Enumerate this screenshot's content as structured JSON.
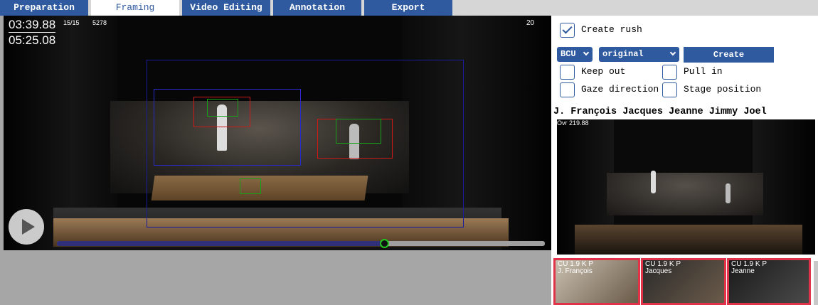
{
  "tabs": [
    {
      "label": "Preparation",
      "active": false
    },
    {
      "label": "Framing",
      "active": true
    },
    {
      "label": "Video Editing",
      "active": false
    },
    {
      "label": "Annotation",
      "active": false
    },
    {
      "label": "Export",
      "active": false
    }
  ],
  "video": {
    "current_time": "03:39.88",
    "total_time": "05:25.08",
    "frame_counter": "15/15",
    "frame_id": "5278",
    "corner_number": "20",
    "progress": 0.67,
    "colors": {
      "frame_outer": "#1b1b9e",
      "frame_inner": "#2a2acc",
      "box_red": "#d01818",
      "box_green": "#18a018",
      "timeline": "#2f2f7a",
      "knob": "#22c81e"
    }
  },
  "controls": {
    "create_rush_label": "Create rush",
    "create_rush_checked": true,
    "shot_size": "BCU",
    "framing_mode": "original",
    "create_label": "Create",
    "options": [
      {
        "label": "Keep out",
        "checked": false
      },
      {
        "label": "Pull in",
        "checked": false
      },
      {
        "label": "Gaze direction",
        "checked": false
      },
      {
        "label": "Stage position",
        "checked": false
      }
    ]
  },
  "actors_line": "J. François Jacques Jeanne Jimmy Joel",
  "preview_label": "Ovr 219.88",
  "thumbnails": [
    {
      "tag": "CU 1.9 K P",
      "name": "J. François"
    },
    {
      "tag": "CU 1.9 K P",
      "name": "Jacques"
    },
    {
      "tag": "CU 1.9 K P",
      "name": "Jeanne"
    }
  ]
}
